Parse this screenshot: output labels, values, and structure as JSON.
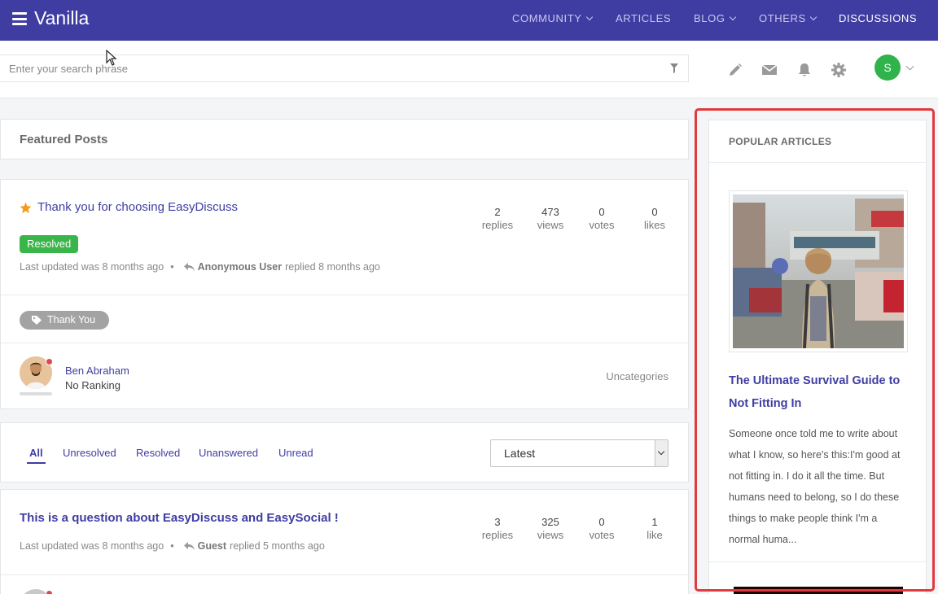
{
  "nav": {
    "brand": "Vanilla",
    "items": [
      {
        "label": "COMMUNITY",
        "has_caret": true
      },
      {
        "label": "ARTICLES",
        "has_caret": false
      },
      {
        "label": "BLOG",
        "has_caret": true
      },
      {
        "label": "OTHERS",
        "has_caret": true
      },
      {
        "label": "DISCUSSIONS",
        "has_caret": false,
        "active": true
      }
    ]
  },
  "toolbar": {
    "search_placeholder": "Enter your search phrase",
    "icons": [
      "pencil-icon",
      "envelope-icon",
      "bell-icon",
      "gear-icon"
    ],
    "user_initial": "S",
    "user_color": "#2fb34a"
  },
  "featured": {
    "heading": "Featured Posts",
    "post": {
      "title": "Thank you for choosing EasyDiscuss",
      "badge": "Resolved",
      "meta_prefix": "Last updated was 8 months ago",
      "bullet": "•",
      "replier": "Anonymous User",
      "meta_suffix": "replied 8 months ago",
      "stats": [
        {
          "value": "2",
          "label": "replies"
        },
        {
          "value": "473",
          "label": "views"
        },
        {
          "value": "0",
          "label": "votes"
        },
        {
          "value": "0",
          "label": "likes"
        }
      ],
      "tag": "Thank You",
      "author_name": "Ben Abraham",
      "author_rank": "No Ranking",
      "category": "Uncategories"
    }
  },
  "filters": {
    "tabs": [
      "All",
      "Unresolved",
      "Resolved",
      "Unanswered",
      "Unread"
    ],
    "active_tab": "All",
    "sort_value": "Latest"
  },
  "posts": [
    {
      "title": "This is a question about EasyDiscuss and EasySocial !",
      "meta_prefix": "Last updated was 8 months ago",
      "bullet": "•",
      "replier": "Guest",
      "meta_suffix": "replied 5 months ago",
      "stats": [
        {
          "value": "3",
          "label": "replies"
        },
        {
          "value": "325",
          "label": "views"
        },
        {
          "value": "0",
          "label": "votes"
        },
        {
          "value": "1",
          "label": "like"
        }
      ]
    }
  ],
  "sidebar": {
    "heading": "POPULAR ARTICLES",
    "article": {
      "title": "The Ultimate Survival Guide to Not Fitting In",
      "excerpt": "Someone once told me to write about what I know, so here's this:I'm good at not fitting in. I do it all the time. But humans need to belong, so I do these things to make people think I'm a normal huma..."
    }
  },
  "colors": {
    "nav_bg": "#3f3da2",
    "link": "#3f3da2",
    "resolved": "#3ab54a",
    "highlight": "#e0393e"
  }
}
